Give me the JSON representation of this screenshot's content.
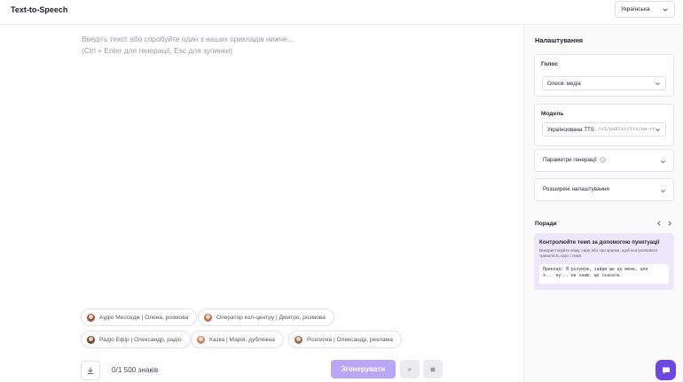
{
  "header": {
    "title": "Text-to-Speech",
    "language_selected": "Українська"
  },
  "editor": {
    "placeholder_line1": "Введіть текст або спробуйте один з наших прикладів нижче...",
    "placeholder_line2": "(Ctrl + Enter для генерації, Esc для зупинки)"
  },
  "examples": [
    {
      "label": "Аудіо Месседж | Олена, розмова",
      "color": "#8a5a44"
    },
    {
      "label": "Оператор кол-центру | Дмитро, розмова",
      "color": "#b07a55"
    },
    {
      "label": "Радіо Ефір | Олександр, радіо",
      "color": "#6b4a3a"
    },
    {
      "label": "Казка | Марія, дубляжна",
      "color": "#c08a6a"
    },
    {
      "label": "Розсилка | Олександр, реклама",
      "color": "#9a6a50"
    }
  ],
  "bottom": {
    "counter": "0/1 500 знаків",
    "generate_label": "Згенерувати"
  },
  "settings": {
    "title": "Налаштування",
    "voice_label": "Голос",
    "voice_value": "Олеся: медіа",
    "model_label": "Модель",
    "model_value": "Українізована TTS",
    "model_path": "/v1/public/tts/ua-rt",
    "gen_params_label": "Параметри генерації",
    "advanced_label": "Розширені налаштування"
  },
  "tips": {
    "title": "Поради",
    "heading": "Контролюйте темп за допомогою пунктуації",
    "body": "Використовуйте кому, тире або три крапки, щоб контролювати тривалість пауз і темп.",
    "example": "Приклад: Я розумію, зайди ще до мене, але\nя... ну... не знаю, що сказать."
  },
  "colors": {
    "accent": "#6c47e6",
    "generate_disabled": "#b9a6f4",
    "tip_bg": "#ede7fb"
  }
}
